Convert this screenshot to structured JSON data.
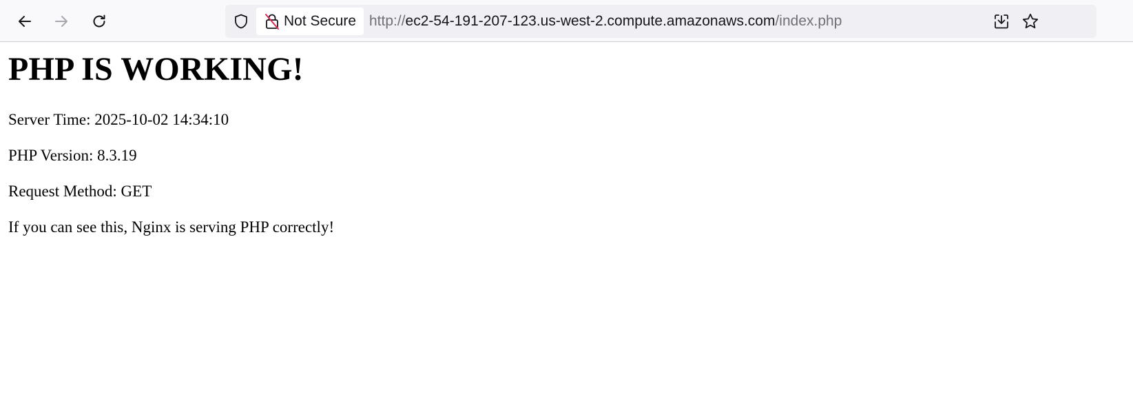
{
  "browser": {
    "security_label": "Not Secure",
    "url_scheme": "http://",
    "url_host": "ec2-54-191-207-123.us-west-2.compute.amazonaws.com",
    "url_path": "/index.php",
    "icons": {
      "back": "arrow-left-icon",
      "forward": "arrow-right-icon",
      "reload": "reload-icon",
      "tracking_protection": "shield-icon",
      "insecure": "insecure-lock-icon",
      "download": "download-icon",
      "bookmark": "star-icon"
    }
  },
  "page": {
    "heading": "PHP IS WORKING!",
    "server_time": "Server Time: 2025-10-02 14:34:10",
    "php_version": "PHP Version: 8.3.19",
    "request_method": "Request Method: GET",
    "message": "If you can see this, Nginx is serving PHP correctly!"
  },
  "colors": {
    "toolbar_bg": "#f9f9fb",
    "urlbar_bg": "#f0f0f4",
    "insecure_red": "#e22850",
    "text": "#000000"
  }
}
